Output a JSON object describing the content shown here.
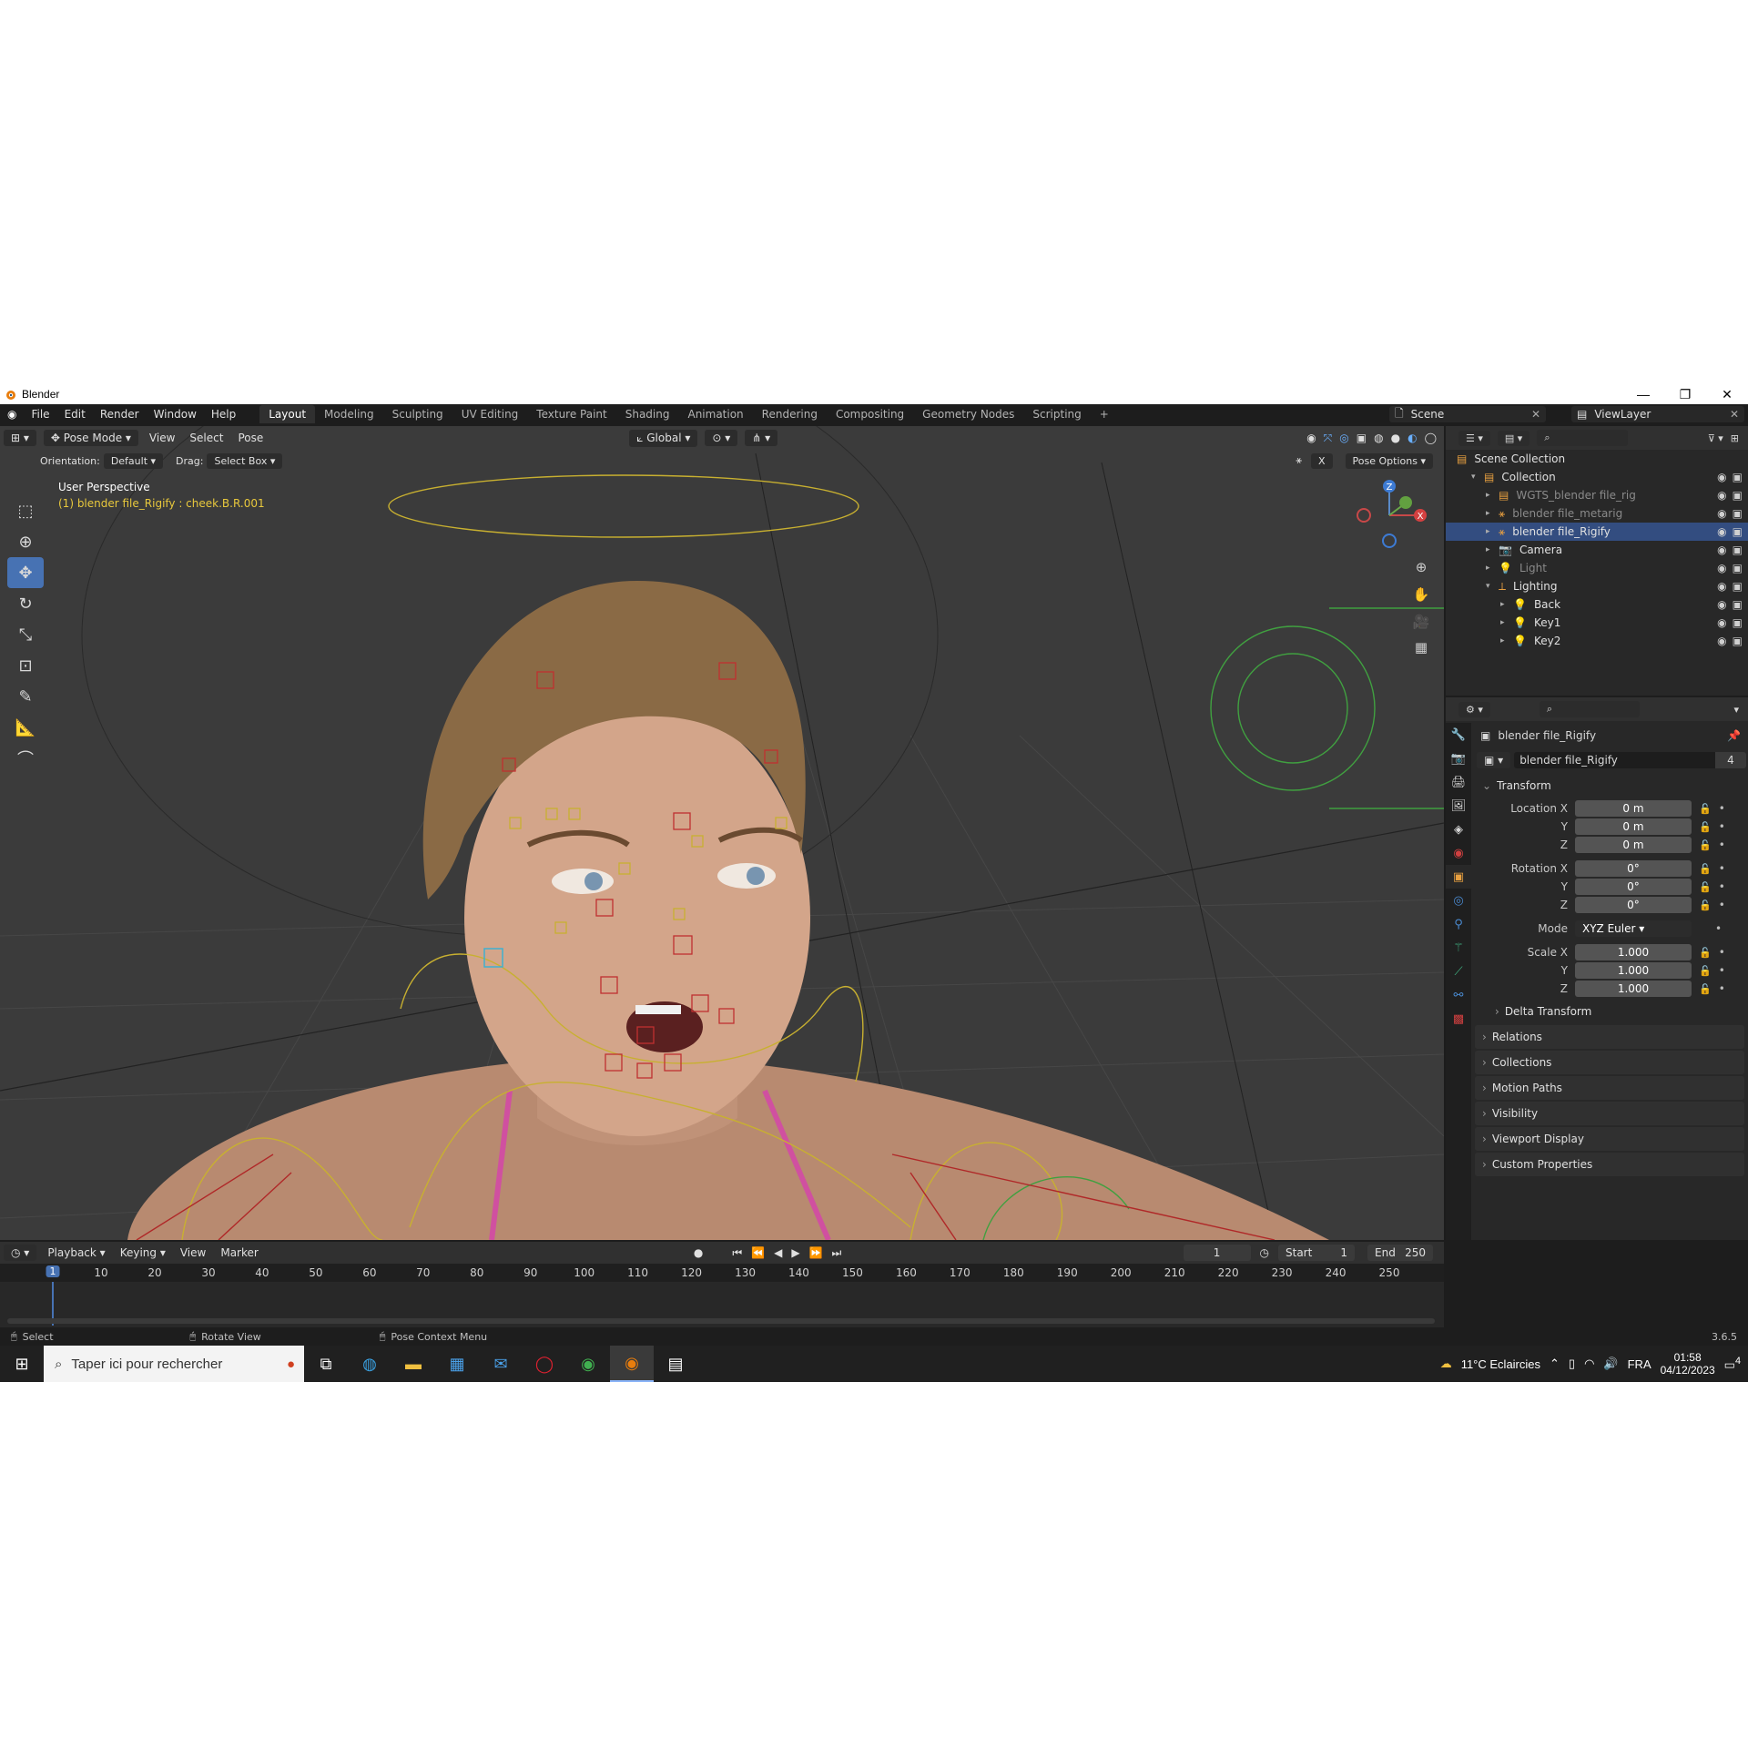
{
  "window": {
    "title": "Blender",
    "minimize": "—",
    "maximize": "❐",
    "close": "✕"
  },
  "menu": [
    "File",
    "Edit",
    "Render",
    "Window",
    "Help"
  ],
  "workspaces": [
    "Layout",
    "Modeling",
    "Sculpting",
    "UV Editing",
    "Texture Paint",
    "Shading",
    "Animation",
    "Rendering",
    "Compositing",
    "Geometry Nodes",
    "Scripting"
  ],
  "active_workspace": "Layout",
  "add_workspace": "+",
  "scene": "Scene",
  "view_layer": "ViewLayer",
  "viewport": {
    "mode": "Pose Mode",
    "menus": [
      "View",
      "Select",
      "Pose"
    ],
    "transform_orientation": "Global",
    "orientation_label": "Orientation:",
    "orientation_value": "Default",
    "drag_label": "Drag:",
    "drag_value": "Select Box",
    "pose_options": "Pose Options",
    "x_mirror": "X",
    "perspective": "User Perspective",
    "active_bone": "(1) blender file_Rigify : cheek.B.R.001",
    "gizmo_axes": {
      "z": "Z",
      "x": "X"
    },
    "colors": {
      "background": "#3b3b3b",
      "grid": "#474747",
      "bone_yellow": "#c8b030",
      "bone_red": "#b02828",
      "bone_green": "#40a040",
      "info_yellow": "#e8c83c"
    }
  },
  "tools": [
    "select-box-icon",
    "cursor-icon",
    "move-icon",
    "rotate-icon",
    "scale-icon",
    "transform-icon",
    "annotate-icon",
    "measure-icon",
    "bone-curve-icon"
  ],
  "outliner": {
    "rows": [
      {
        "label": "Scene Collection",
        "indent": 0,
        "state": "normal"
      },
      {
        "label": "Collection",
        "indent": 1,
        "state": "normal"
      },
      {
        "label": "WGTS_blender file_rig",
        "indent": 2,
        "state": "dim"
      },
      {
        "label": "blender file_metarig",
        "indent": 2,
        "state": "dim"
      },
      {
        "label": "blender file_Rigify",
        "indent": 2,
        "state": "selected"
      },
      {
        "label": "Camera",
        "indent": 2,
        "state": "normal"
      },
      {
        "label": "Light",
        "indent": 2,
        "state": "dim"
      },
      {
        "label": "Lighting",
        "indent": 2,
        "state": "normal"
      },
      {
        "label": "Back",
        "indent": 3,
        "state": "normal"
      },
      {
        "label": "Key1",
        "indent": 3,
        "state": "normal"
      },
      {
        "label": "Key2",
        "indent": 3,
        "state": "normal"
      }
    ]
  },
  "properties": {
    "object_name": "blender file_Rigify",
    "data_name": "blender file_Rigify",
    "users": "4",
    "transform_header": "Transform",
    "location": {
      "label": "Location X",
      "x": "0 m",
      "y": "0 m",
      "z": "0 m"
    },
    "rotation": {
      "label": "Rotation X",
      "x": "0°",
      "y": "0°",
      "z": "0°"
    },
    "mode_label": "Mode",
    "mode_value": "XYZ Euler",
    "scale": {
      "label": "Scale X",
      "x": "1.000",
      "y": "1.000",
      "z": "1.000"
    },
    "axis_y": "Y",
    "axis_z": "Z",
    "delta_transform": "Delta Transform",
    "panels": [
      "Relations",
      "Collections",
      "Motion Paths",
      "Visibility",
      "Viewport Display",
      "Custom Properties"
    ]
  },
  "timeline": {
    "menus": [
      "Playback",
      "Keying",
      "View",
      "Marker"
    ],
    "current_frame": "1",
    "start_label": "Start",
    "start": "1",
    "end_label": "End",
    "end": "250",
    "ticks": [
      "10",
      "20",
      "30",
      "40",
      "50",
      "60",
      "70",
      "80",
      "90",
      "100",
      "110",
      "120",
      "130",
      "140",
      "150",
      "160",
      "170",
      "180",
      "190",
      "200",
      "210",
      "220",
      "230",
      "240",
      "250"
    ]
  },
  "statusbar": {
    "select": "Select",
    "rotate": "Rotate View",
    "context": "Pose Context Menu",
    "version": "3.6.5"
  },
  "taskbar": {
    "search_placeholder": "Taper ici pour rechercher",
    "weather": "11°C  Eclaircies",
    "language": "FRA",
    "time": "01:58",
    "date": "04/12/2023",
    "notifications": "4"
  }
}
